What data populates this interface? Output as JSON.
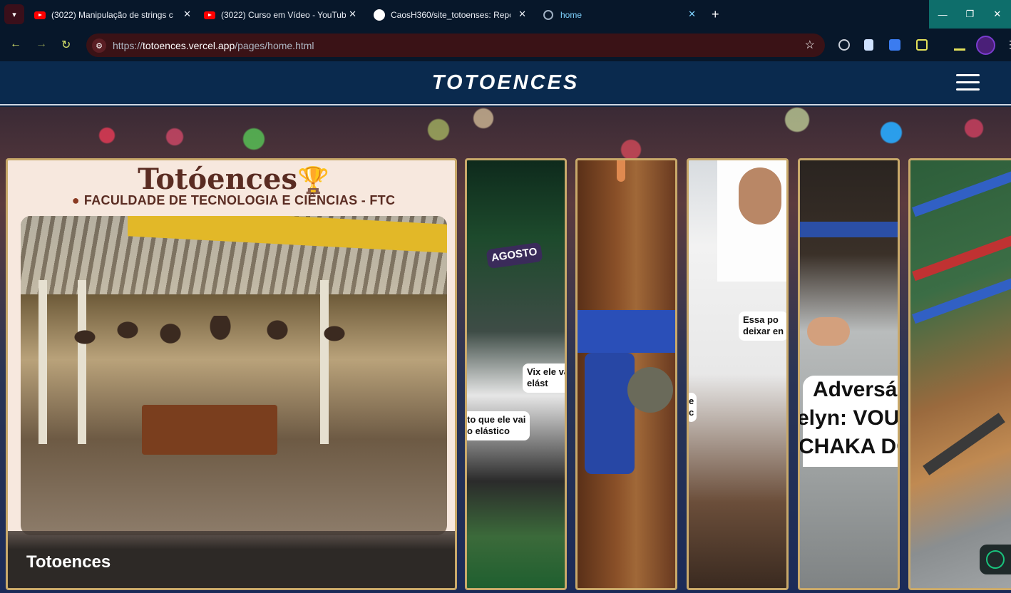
{
  "browser": {
    "tabs": [
      {
        "title": "(3022) Manipulação de strings c",
        "icon": "youtube-icon"
      },
      {
        "title": "(3022) Curso em Vídeo - YouTub",
        "icon": "youtube-icon"
      },
      {
        "title": "CaosH360/site_totoenses: Repo",
        "icon": "github-icon"
      },
      {
        "title": "home",
        "icon": "globe-icon",
        "active": true
      }
    ],
    "new_tab": "+",
    "url_prefix": "https://",
    "url_domain": "totoences.vercel.app",
    "url_path": "/pages/home.html",
    "window_controls": [
      "—",
      "❐",
      "✕"
    ]
  },
  "site": {
    "brand": "TOTOENCES"
  },
  "cards": {
    "main": {
      "poster_title": "Totóences",
      "poster_trophy": "🏆",
      "poster_subtitle": "FACULDADE DE TECNOLOGIA E CIÊNCIAS - FTC",
      "caption": "Totoences"
    },
    "c1": {
      "banner": "AGOSTO",
      "bubble_1": "Vix ele va\nelást",
      "bubble_2": "to que ele vai\no elástico"
    },
    "c3": {
      "bubble_1": "Essa po\ndeixar en",
      "bubble_2": "e\nc"
    },
    "c4": {
      "line_1": "Adversá",
      "line_2": "elyn: VOU",
      "line_3": "CHAKA DO"
    }
  },
  "colors": {
    "header_bg": "#0a2a4e",
    "card_border": "#c9a96a",
    "tab_active": "#7fd3ff"
  }
}
